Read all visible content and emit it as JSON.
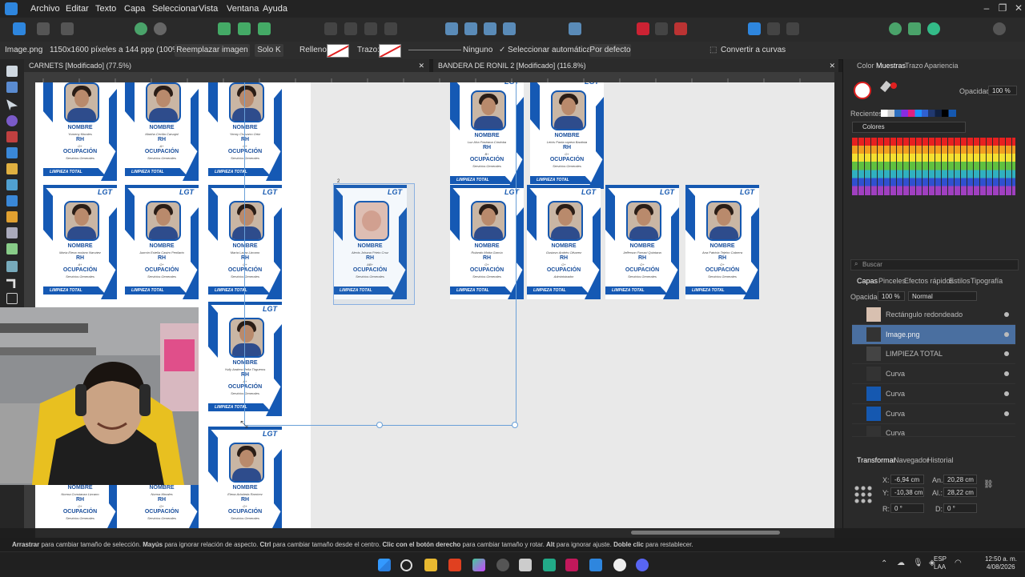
{
  "menu": [
    "Archivo",
    "Editar",
    "Texto",
    "Capa",
    "Seleccionar",
    "Vista",
    "Ventana",
    "Ayuda"
  ],
  "context": {
    "layer_name": "Image.png",
    "image_info": "1150x1600 píxeles a 144 ppp (100%)",
    "replace_image": "Reemplazar imagen",
    "solo_k": "Solo K",
    "fill_label": "Relleno:",
    "stroke_label": "Trazo:",
    "stroke_value": "Ninguno",
    "auto_select": "Seleccionar automáticamente:",
    "auto_select_value": "Por defecto",
    "convert_curves": "Convertir a curvas"
  },
  "tabs": {
    "left": "CARNETS [Modificado] (77.5%)",
    "right": "BANDERA DE RONIL 2 [Modificado] (116.8%)"
  },
  "card_text": {
    "nombre": "NOMBRE",
    "rh": "RH",
    "ocupacion": "OCUPACIÓN",
    "servicios": "Servicios Generales",
    "administrador": "Administrador",
    "footer": "LIMPIEZA TOTAL",
    "logo": "LGT"
  },
  "cards": [
    {
      "name": "Yomeny Morales",
      "rh": "O+"
    },
    {
      "name": "Martha Cecilia Carvajal",
      "rh": "A+"
    },
    {
      "name": "Yenny Chavarro Ortiz",
      "rh": "O+"
    },
    {
      "name": "María Elena molano Narváez",
      "rh": "A+"
    },
    {
      "name": "Jazmín Estella Castro Penilarto",
      "rh": "O+"
    },
    {
      "name": "María Laura Lizcano",
      "rh": "O+"
    },
    {
      "name": "Yully Andrea Peña Tirgueros",
      "rh": "A+"
    },
    {
      "name": "Elena Arboleda Ramírez",
      "rh": "O+"
    },
    {
      "name": "Norma Constanza Lizcano",
      "rh": "O+"
    },
    {
      "name": "Norma Morales",
      "rh": "O+"
    },
    {
      "name": "Alexis Johana Prieto Cruz",
      "rh": "AB+"
    },
    {
      "name": "Luz Aïra Pastrana Córdoba",
      "rh": "B+"
    },
    {
      "name": "Leivis Paola capera Bautista",
      "rh": "O+"
    },
    {
      "name": "Rolando Motta García",
      "rh": "O+"
    },
    {
      "name": "Gustavo Andrés Olivarez",
      "rh": "O+"
    },
    {
      "name": "Jefferson Parraci Quintana",
      "rh": "O+"
    },
    {
      "name": "Ana Patricia Tejeiro Cabrera",
      "rh": "O+"
    }
  ],
  "panels": {
    "top_tabs": [
      "Color",
      "Muestras",
      "Trazo",
      "Apariencia"
    ],
    "opacity_label": "Opacidad:",
    "opacity_value": "100 %",
    "recent_label": "Recientes:",
    "colors_dropdown": "Colores",
    "search_placeholder": "Buscar",
    "layer_tabs": [
      "Capas",
      "Pinceles",
      "Efectos rápidos",
      "Estilos",
      "Tipografía"
    ],
    "layer_opacity": "100 %",
    "blend_mode": "Normal",
    "layers": [
      "Rectángulo redondeado",
      "Image.png",
      "LIMPIEZA TOTAL",
      "Curva",
      "Curva",
      "Curva",
      "Curva"
    ],
    "transform_tabs": [
      "Transformar",
      "Navegador",
      "Historial"
    ],
    "x_label": "X:",
    "x_value": "-6,94 cm",
    "y_label": "Y:",
    "y_value": "-10,38 cm",
    "w_label": "An.:",
    "w_value": "20,28 cm",
    "h_label": "Al.:",
    "h_value": "28,22 cm",
    "r_label": "R:",
    "r_value": "0 °",
    "s_label": "D:",
    "s_value": "0 °"
  },
  "status": {
    "k1": "Arrastrar",
    "t1": " para cambiar tamaño de selección. ",
    "k2": "Mayús",
    "t2": " para ignorar relación de aspecto. ",
    "k3": "Ctrl",
    "t3": " para cambiar tamaño desde el centro. ",
    "k4": "Clic con el botón derecho",
    "t4": " para cambiar tamaño y rotar. ",
    "k5": "Alt",
    "t5": " para ignorar ajuste. ",
    "k6": "Doble clic",
    "t6": " para restablecer."
  },
  "taskbar": {
    "lang1": "ESP",
    "lang2": "LAA",
    "time": "12:50 a. m.",
    "date": "4/08/2026"
  },
  "colors": {
    "brand": "#1558b0",
    "accent": "#2e86de"
  },
  "selection_marker": "2"
}
